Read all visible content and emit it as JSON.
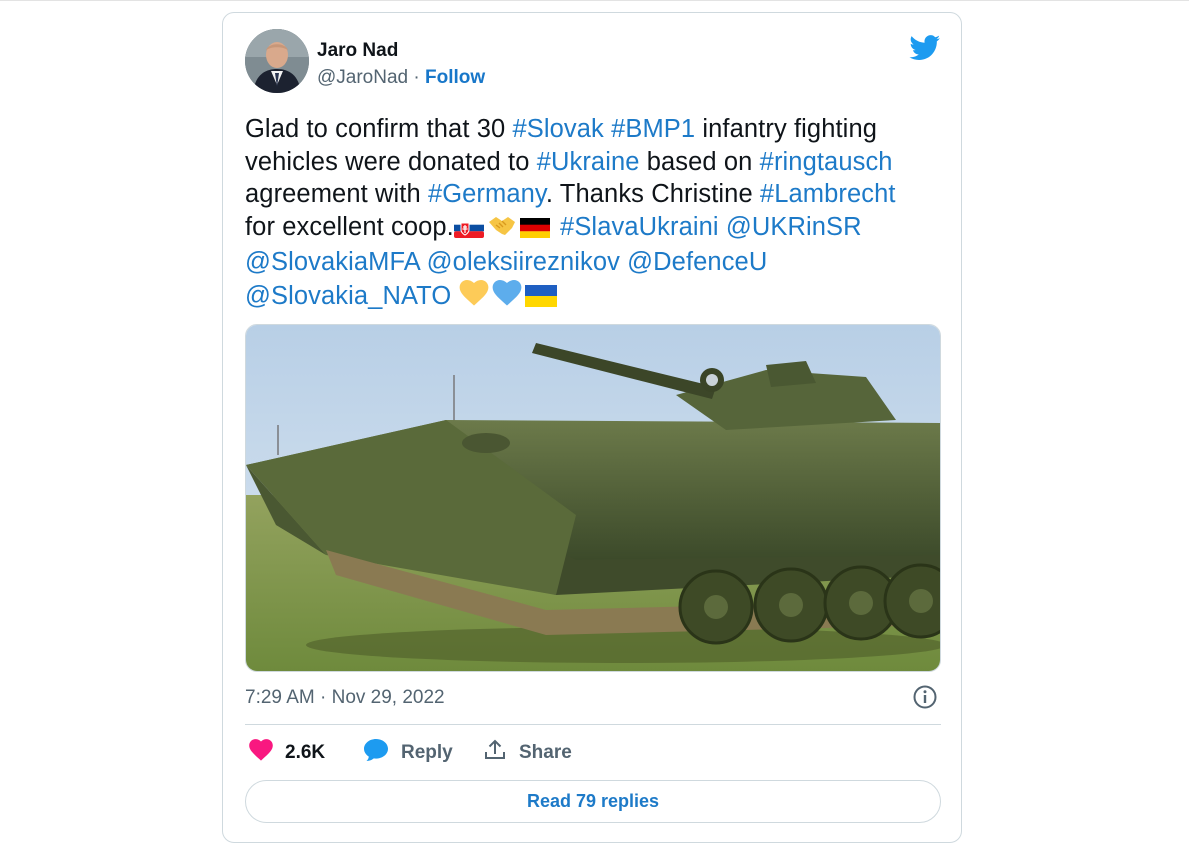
{
  "author": {
    "name": "Jaro Nad",
    "handle": "@JaroNad",
    "separator": "·",
    "follow_label": "Follow"
  },
  "tweet": {
    "lines": [
      [
        {
          "t": "Glad to confirm that 30 "
        },
        {
          "t": "#Slovak",
          "link": true
        },
        {
          "t": " "
        },
        {
          "t": "#BMP1",
          "link": true
        },
        {
          "t": " infantry fighting"
        }
      ],
      [
        {
          "t": "vehicles were donated to "
        },
        {
          "t": "#Ukraine",
          "link": true
        },
        {
          "t": " based on "
        },
        {
          "t": "#ringtausch",
          "link": true
        }
      ],
      [
        {
          "t": "agreement with "
        },
        {
          "t": "#Germany",
          "link": true
        },
        {
          "t": ". Thanks Christine "
        },
        {
          "t": "#Lambrecht",
          "link": true
        }
      ],
      [
        {
          "t": "for excellent coop."
        },
        {
          "emoji": "flag-slovakia"
        },
        {
          "emoji": "handshake"
        },
        {
          "emoji": "flag-germany"
        },
        {
          "t": " "
        },
        {
          "t": "#SlavaUkraini",
          "link": true
        },
        {
          "t": " "
        },
        {
          "t": "@UKRinSR",
          "link": true
        }
      ],
      [
        {
          "t": "@SlovakiaMFA",
          "link": true
        },
        {
          "t": " "
        },
        {
          "t": "@oleksiireznikov",
          "link": true
        },
        {
          "t": " "
        },
        {
          "t": "@DefenceU",
          "link": true
        }
      ],
      [
        {
          "t": "@Slovakia_NATO",
          "link": true
        },
        {
          "t": " "
        },
        {
          "emoji": "yellow-heart"
        },
        {
          "emoji": "blue-heart"
        },
        {
          "emoji": "flag-ukraine"
        }
      ]
    ]
  },
  "media": {
    "alt": "BMP-1 infantry fighting vehicle on grass"
  },
  "timestamp": "7:29 AM · Nov 29, 2022",
  "actions": {
    "like_count": "2.6K",
    "reply_label": "Reply",
    "share_label": "Share"
  },
  "read_replies_label": "Read 79 replies",
  "colors": {
    "link": "#1d7ac8",
    "like": "#f91880",
    "reply": "#1d9bf0",
    "twitter_blue": "#1d9bf0"
  },
  "icons": [
    "twitter-bird-icon",
    "info-icon",
    "heart-icon",
    "reply-bubble-icon",
    "share-icon"
  ]
}
